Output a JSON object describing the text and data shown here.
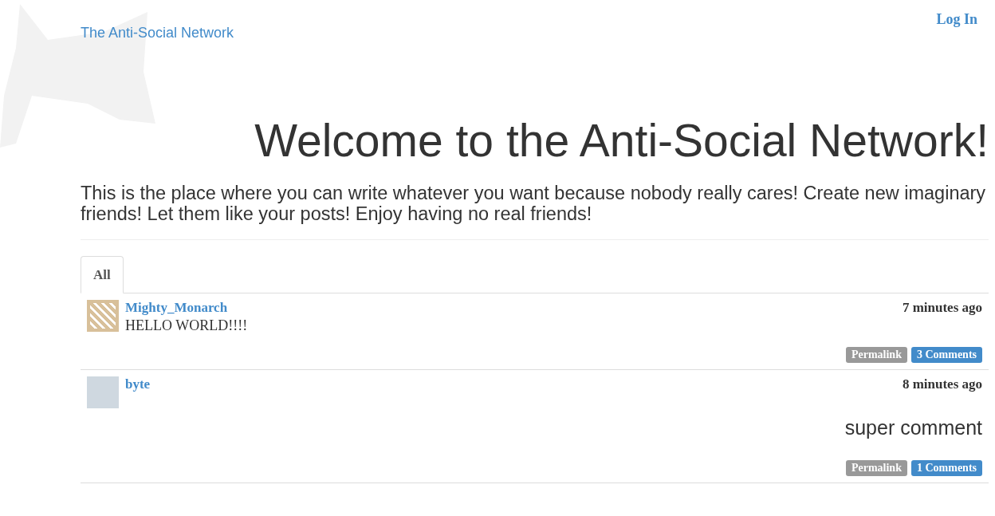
{
  "brand": "The Anti-Social Network",
  "login": "Log In",
  "hero": {
    "title": "Welcome to the Anti-Social Network!",
    "lead": "This is the place where you can write whatever you want because nobody really cares! Create new imaginary friends! Let them like your posts! Enjoy having no real friends!"
  },
  "tabs": [
    {
      "label": "All",
      "selected": true
    }
  ],
  "posts": [
    {
      "author": "Mighty_Monarch",
      "avatar": {
        "kind": "pattern"
      },
      "time": "7 minutes ago",
      "kind": "plain",
      "body": "HELLO WORLD!!!!",
      "permalink": "Permalink",
      "comments": "3 Comments"
    },
    {
      "author": "byte",
      "avatar": {
        "kind": "photo"
      },
      "time": "8 minutes ago",
      "kind": "large",
      "body": "super comment",
      "permalink": "Permalink",
      "comments": "1 Comments"
    }
  ]
}
